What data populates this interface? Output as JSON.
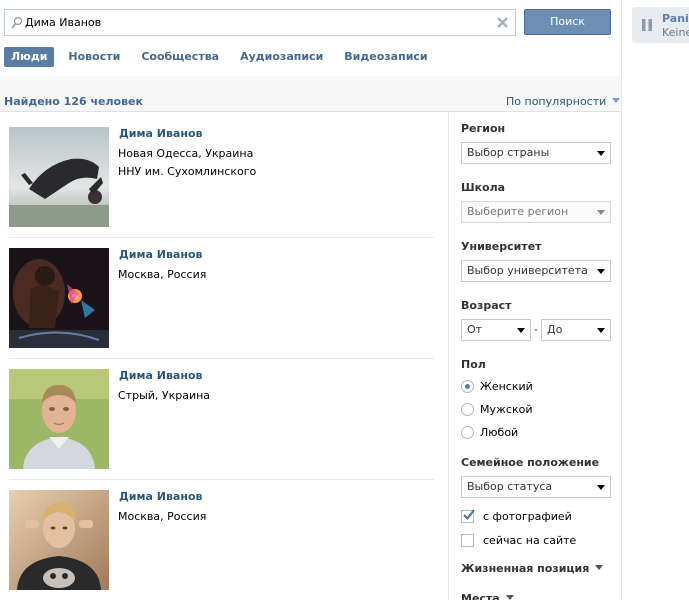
{
  "search": {
    "query": "Дима Иванов",
    "button_label": "Поиск"
  },
  "tabs": [
    {
      "label": "Люди",
      "active": true
    },
    {
      "label": "Новости",
      "active": false
    },
    {
      "label": "Сообщества",
      "active": false
    },
    {
      "label": "Аудиозаписи",
      "active": false
    },
    {
      "label": "Видеозаписи",
      "active": false
    }
  ],
  "results_header": {
    "found_text": "Найдено 126 человек",
    "sort_label": "По популярности"
  },
  "people": [
    {
      "name": "Дима Иванов",
      "line1": "Новая Одесса, Украина",
      "line2": "ННУ им. Сухомлинского"
    },
    {
      "name": "Дима Иванов",
      "line1": "Москва, Россия",
      "line2": ""
    },
    {
      "name": "Дима Иванов",
      "line1": "Стрый, Украина",
      "line2": ""
    },
    {
      "name": "Дима Иванов",
      "line1": "Москва, Россия",
      "line2": ""
    }
  ],
  "filters": {
    "region": {
      "label": "Регион",
      "value": "Выбор страны"
    },
    "school": {
      "label": "Школа",
      "value": "Выберите регион"
    },
    "university": {
      "label": "Университет",
      "value": "Выбор университета"
    },
    "age": {
      "label": "Возраст",
      "from": "От",
      "to": "До",
      "separator": "-"
    },
    "gender": {
      "label": "Пол",
      "options": [
        {
          "label": "Женский",
          "selected": true
        },
        {
          "label": "Мужской",
          "selected": false
        },
        {
          "label": "Любой",
          "selected": false
        }
      ]
    },
    "marital": {
      "label": "Семейное положение",
      "value": "Выбор статуса"
    },
    "with_photo": {
      "label": "с фотографией",
      "checked": true
    },
    "online_now": {
      "label": "сейчас на сайте",
      "checked": false
    },
    "life_position": {
      "label": "Жизненная позиция"
    },
    "places": {
      "label": "Места"
    }
  },
  "notification": {
    "title": "Panik",
    "subtitle": "Keiner"
  },
  "colors": {
    "accent": "#597da3",
    "link": "#2b587a",
    "button": "#6d8fb3"
  }
}
